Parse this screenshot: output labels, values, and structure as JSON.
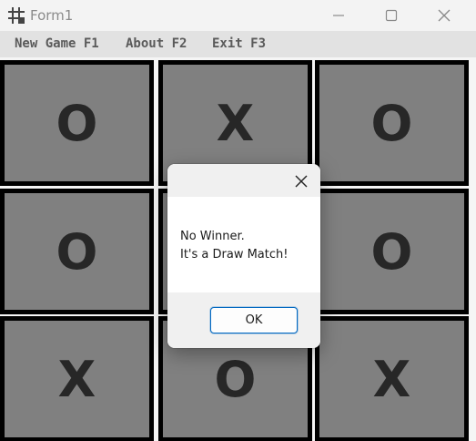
{
  "window": {
    "title": "Form1",
    "icons": {
      "app": "grid-app-icon",
      "minimize": "minimize-icon",
      "maximize": "maximize-icon",
      "close": "close-icon"
    }
  },
  "menu": {
    "items": [
      {
        "label": "New Game F1"
      },
      {
        "label": "About F2"
      },
      {
        "label": "Exit F3"
      }
    ]
  },
  "board": {
    "cells": [
      {
        "mark": "O"
      },
      {
        "mark": "X"
      },
      {
        "mark": "O"
      },
      {
        "mark": "O"
      },
      {
        "mark": ""
      },
      {
        "mark": "O"
      },
      {
        "mark": "X"
      },
      {
        "mark": "O"
      },
      {
        "mark": "X"
      }
    ],
    "colors": {
      "cell_fill": "#808080",
      "cell_border": "#000000",
      "mark": "#272727"
    }
  },
  "dialog": {
    "line1": "No Winner.",
    "line2": "It's a Draw Match!",
    "ok_label": "OK",
    "colors": {
      "ok_border": "#0067c0"
    }
  }
}
